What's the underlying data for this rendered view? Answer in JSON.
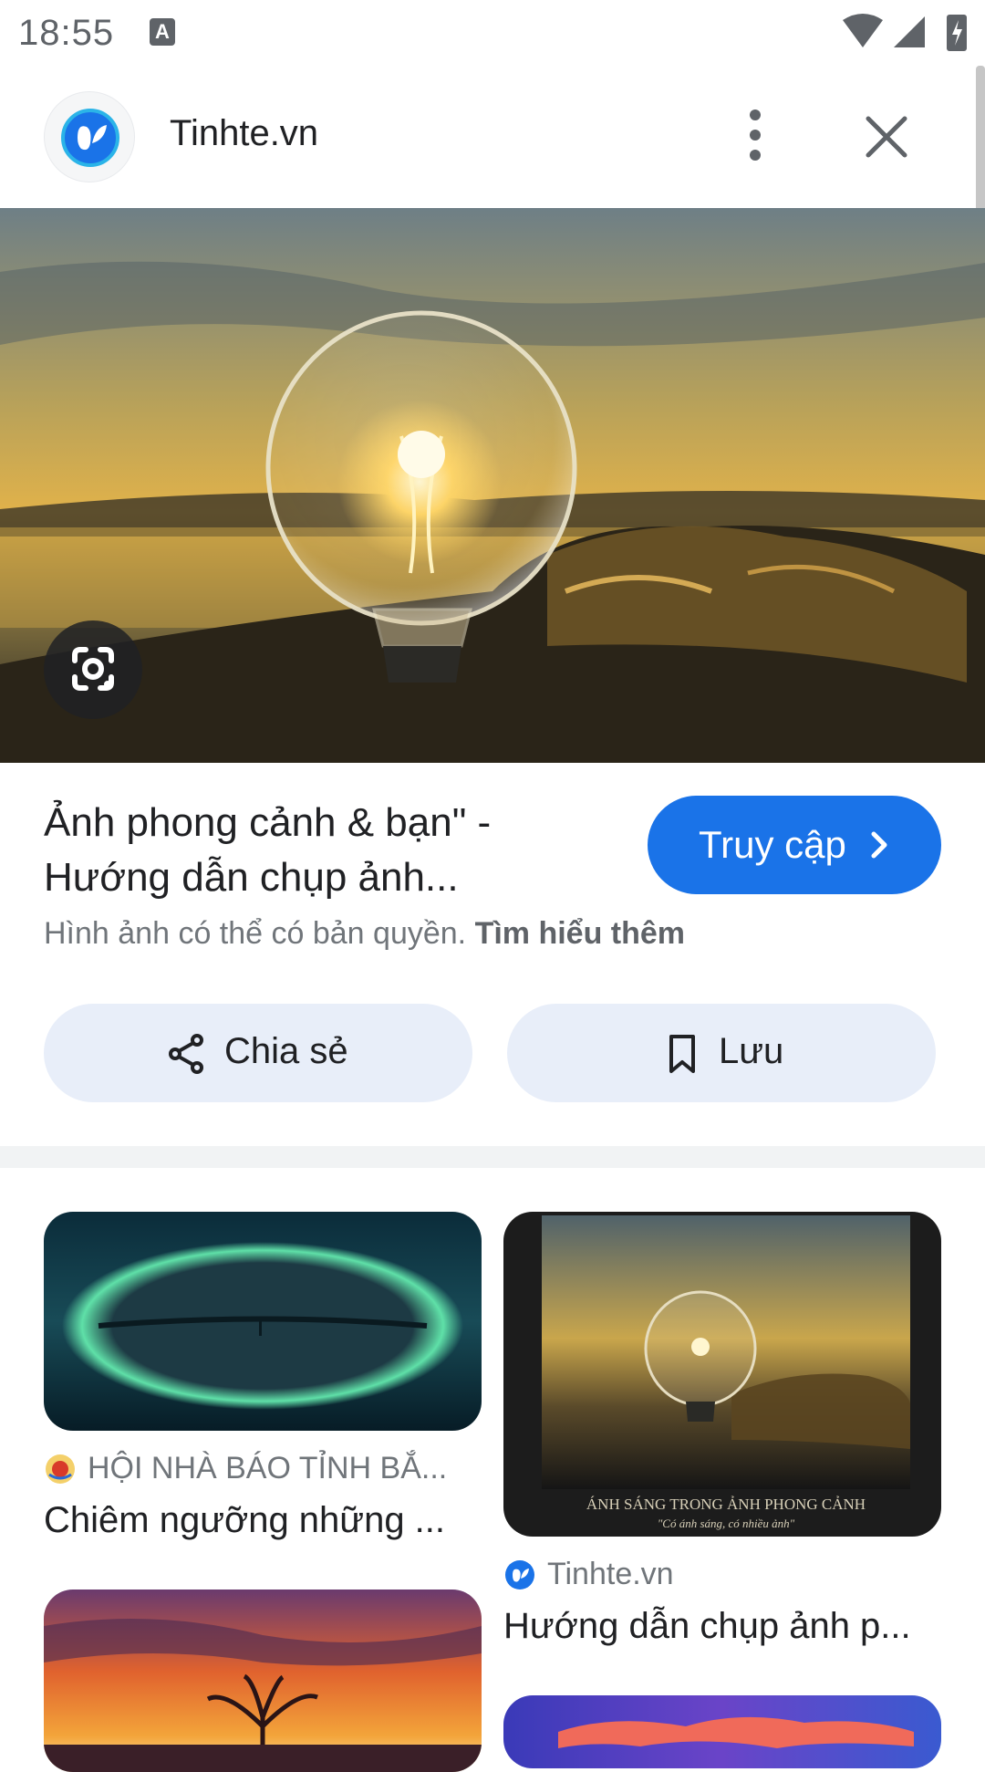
{
  "status_bar": {
    "time": "18:55",
    "notification_icon_letter": "A"
  },
  "header": {
    "site_name": "Tinhte.vn",
    "site_icon": "tinhte-logo-icon",
    "more_icon": "more-vert-icon",
    "close_icon": "close-icon"
  },
  "hero": {
    "lens_icon": "google-lens-icon"
  },
  "info": {
    "title": "Ảnh phong cảnh & bạn\" - Hướng dẫn chụp ảnh...",
    "visit_label": "Truy cập",
    "copyright_text": "Hình ảnh có thể có bản quyền.",
    "learn_more": "Tìm hiểu thêm",
    "share_label": "Chia sẻ",
    "save_label": "Lưu"
  },
  "related": [
    {
      "source": "HỘI NHÀ BÁO TỈNH BẮ...",
      "caption": "Chiêm ngưỡng những ..."
    },
    {
      "source": "Tinhte.vn",
      "caption": "Hướng dẫn chụp ảnh p...",
      "image_caption_line1": "ÁNH SÁNG TRONG ẢNH PHONG CẢNH",
      "image_caption_line2": "\"Có ánh sáng, có nhiều ảnh\""
    }
  ],
  "colors": {
    "accent": "#1a73e8",
    "pill_bg": "#e8eef9"
  }
}
